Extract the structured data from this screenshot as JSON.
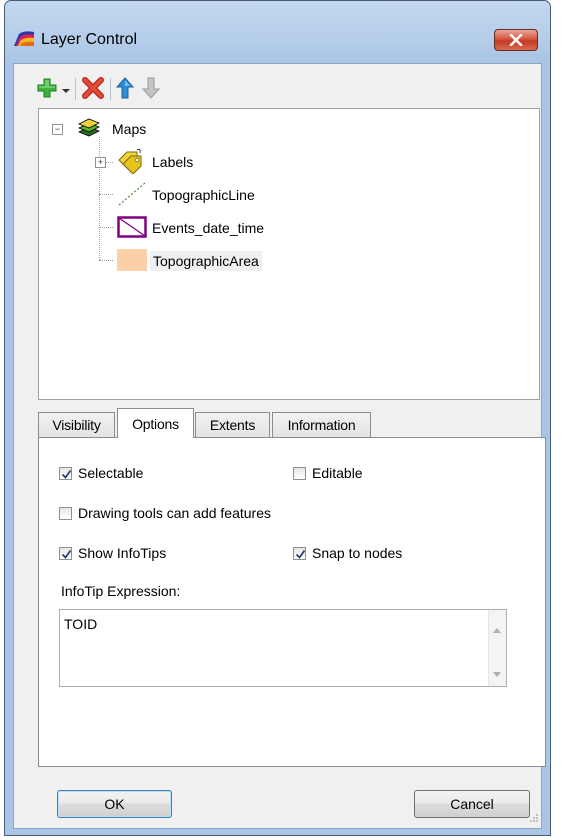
{
  "window": {
    "title": "Layer Control",
    "close_glyph": "✕"
  },
  "icons": {
    "app": "layer-control-app-icon",
    "add": "green-plus-icon",
    "dropdown": "dropdown-arrow-icon",
    "remove": "red-x-icon",
    "up": "arrow-up-icon",
    "down": "arrow-down-icon"
  },
  "tree": {
    "root": {
      "label": "Maps",
      "expander": "−"
    },
    "layers": [
      {
        "label": "Labels",
        "expander": "+",
        "icon": "labels-tag-icon"
      },
      {
        "label": "TopographicLine",
        "icon": "line-style-icon"
      },
      {
        "label": "Events_date_time",
        "icon": "hatched-region-icon"
      },
      {
        "label": "TopographicArea",
        "icon": "area-fill-icon",
        "selected": true
      }
    ]
  },
  "tabs": [
    {
      "label": "Visibility"
    },
    {
      "label": "Options",
      "active": true
    },
    {
      "label": "Extents"
    },
    {
      "label": "Information"
    }
  ],
  "options": {
    "selectable": {
      "label": "Selectable",
      "checked": true
    },
    "editable": {
      "label": "Editable",
      "checked": false
    },
    "drawing_tools": {
      "label": "Drawing tools can add features",
      "checked": false
    },
    "show_infotips": {
      "label": "Show InfoTips",
      "checked": true
    },
    "snap_to_nodes": {
      "label": "Snap to nodes",
      "checked": true
    },
    "infotip_label": "InfoTip Expression:",
    "infotip_value": "TOID"
  },
  "buttons": {
    "ok": "OK",
    "cancel": "Cancel"
  },
  "colors": {
    "area_fill": "#fbd0a8",
    "region_border": "#800080",
    "line_color": "#4a8a3a",
    "add_green": "#3cb43c",
    "remove_red": "#d83a2a",
    "arrow_blue": "#2c8fd6",
    "arrow_gray": "#b0b0b0"
  }
}
